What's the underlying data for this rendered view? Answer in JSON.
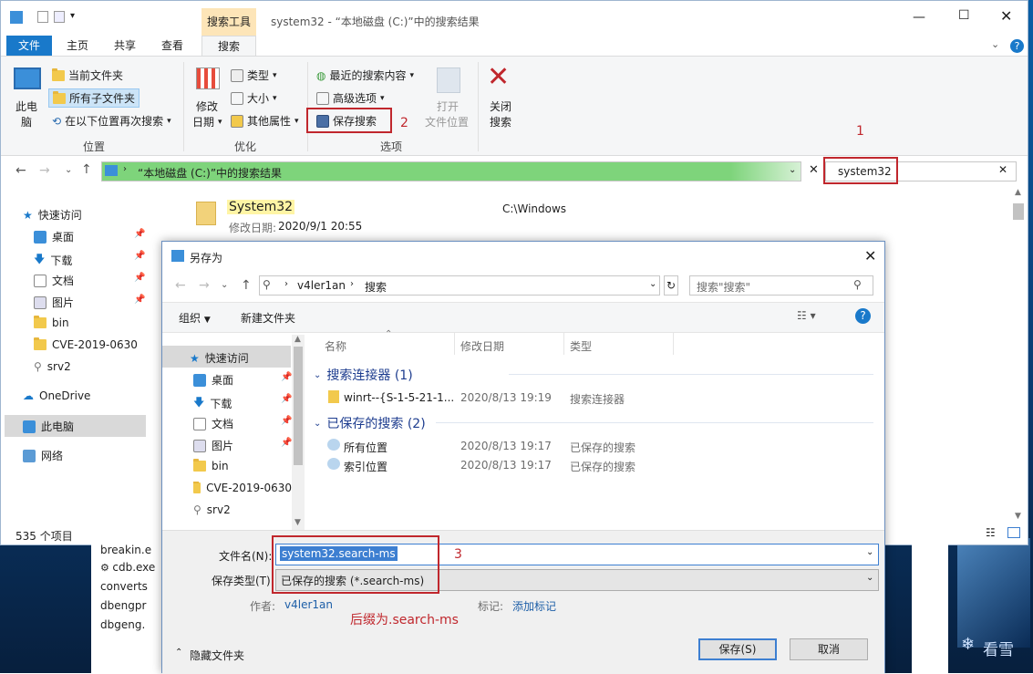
{
  "explorer": {
    "title_context_tab": "搜索工具",
    "title": "system32 - “本地磁盘 (C:)”中的搜索结果",
    "tabs": [
      "文件",
      "主页",
      "共享",
      "查看",
      "搜索"
    ],
    "ribbon": {
      "this_pc_line1": "此电",
      "this_pc_line2": "脑",
      "current_folder": "当前文件夹",
      "all_subfolders": "所有子文件夹",
      "search_again_in": "在以下位置再次搜索",
      "group_location": "位置",
      "date_modified_line1": "修改",
      "date_modified_line2": "日期",
      "type": "类型",
      "size": "大小",
      "other_properties": "其他属性",
      "group_refine": "优化",
      "recent_searches": "最近的搜索内容",
      "advanced_options": "高级选项",
      "save_search": "保存搜索",
      "open_location_line1": "打开",
      "open_location_line2": "文件位置",
      "group_options": "选项",
      "close_search_line1": "关闭",
      "close_search_line2": "搜索"
    },
    "address": "“本地磁盘 (C:)”中的搜索结果",
    "search_value": "system32",
    "nav": [
      "快速访问",
      "桌面",
      "下载",
      "文档",
      "图片",
      "bin",
      "CVE-2019-0630",
      "srv2",
      "OneDrive",
      "此电脑",
      "网络"
    ],
    "result": {
      "name": "System32",
      "date_label": "修改日期:",
      "date": "2020/9/1 20:55",
      "path": "C:\\Windows"
    },
    "status": "535 个项目",
    "behind_files": [
      "breakin.e",
      "cdb.exe",
      "converts",
      "dbengpr",
      "dbgeng."
    ]
  },
  "annotations": {
    "n1": "1",
    "n2": "2",
    "n3": "3",
    "suffix_note": "后缀为.search-ms"
  },
  "dialog": {
    "title": "另存为",
    "breadcrumb": [
      "v4ler1an",
      "搜索"
    ],
    "search_placeholder": "搜索\"搜索\"",
    "organize": "组织",
    "new_folder": "新建文件夹",
    "nav": [
      "快速访问",
      "桌面",
      "下载",
      "文档",
      "图片",
      "bin",
      "CVE-2019-0630",
      "srv2"
    ],
    "columns": [
      "名称",
      "修改日期",
      "类型"
    ],
    "groups": [
      {
        "label": "搜索连接器 (1)",
        "items": [
          {
            "name": "winrt--{S-1-5-21-1...",
            "date": "2020/8/13 19:19",
            "type": "搜索连接器"
          }
        ]
      },
      {
        "label": "已保存的搜索 (2)",
        "items": [
          {
            "name": "所有位置",
            "date": "2020/8/13 19:17",
            "type": "已保存的搜索"
          },
          {
            "name": "索引位置",
            "date": "2020/8/13 19:17",
            "type": "已保存的搜索"
          }
        ]
      }
    ],
    "filename_label": "文件名(N):",
    "filename_value": "system32.search-ms",
    "savetype_label": "保存类型(T):",
    "savetype_value": "已保存的搜索 (*.search-ms)",
    "author_label": "作者:",
    "author_value": "v4ler1an",
    "tags_label": "标记:",
    "tags_value": "添加标记",
    "hide_folders": "隐藏文件夹",
    "save_btn": "保存(S)",
    "cancel_btn": "取消"
  },
  "watermark": "看雪",
  "colors": {
    "accent": "#1979ca",
    "address_fill": "#7ed47b",
    "annotation": "#c0272d",
    "highlight": "#fff5a5"
  }
}
